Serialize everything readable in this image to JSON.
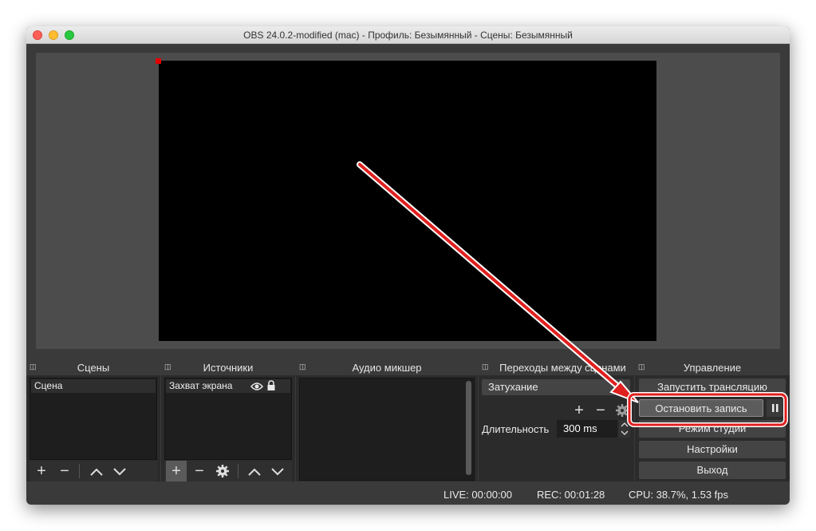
{
  "window": {
    "title": "OBS 24.0.2-modified (mac) - Профиль: Безымянный - Сцены: Безымянный"
  },
  "docks": {
    "scenes": {
      "title": "Сцены",
      "items": [
        "Сцена"
      ]
    },
    "sources": {
      "title": "Источники",
      "items": [
        "Захват экрана"
      ]
    },
    "mixer": {
      "title": "Аудио микшер"
    },
    "transitions": {
      "title": "Переходы между сценами",
      "selected": "Затухание",
      "duration_label": "Длительность",
      "duration_value": "300 ms"
    },
    "controls": {
      "title": "Управление",
      "start_stream": "Запустить трансляцию",
      "stop_recording": "Остановить запись",
      "studio_mode": "Режим студии",
      "settings": "Настройки",
      "exit": "Выход"
    }
  },
  "status": {
    "live": "LIVE: 00:00:00",
    "rec": "REC: 00:01:28",
    "cpu": "CPU: 38.7%, 1.53 fps"
  },
  "icons": {
    "add": "+",
    "remove": "−",
    "up": "chevron-up-icon",
    "down": "chevron-down-icon",
    "settings": "gear-icon",
    "visible": "eye-icon",
    "lock": "lock-icon",
    "pause": "pause-icon",
    "dock": "dock-float-icon"
  },
  "colors": {
    "annotation_red": "#e0201e",
    "window_bg": "#3a3a3a",
    "preview_bg": "#4c4c4c"
  }
}
